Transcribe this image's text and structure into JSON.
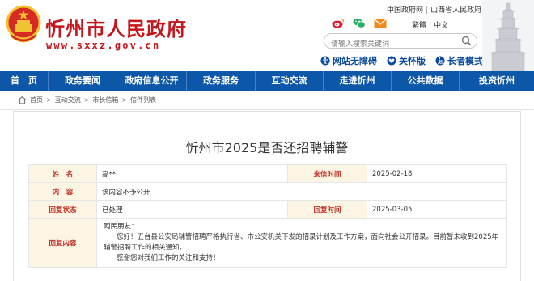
{
  "header": {
    "site_title": "忻州市人民政府",
    "site_url": "www.sxxz.gov.cn",
    "top_links": [
      "中国政府网",
      "山西省人民政府"
    ],
    "languages": [
      "繁體",
      "中文"
    ],
    "search_placeholder": "请输入搜索关键词",
    "tools": [
      "网站无障碍",
      "关怀版",
      "长者模式"
    ]
  },
  "nav": {
    "items": [
      "首　页",
      "政务要闻",
      "政府信息公开",
      "政务服务",
      "互动交流",
      "走进忻州",
      "公共数据",
      "投资忻州"
    ]
  },
  "breadcrumb": [
    "首页",
    "互动交流",
    "市长信箱",
    "信件列表"
  ],
  "letter": {
    "title": "忻州市2025是否还招聘辅警",
    "name_label": "姓　名",
    "name_value": "高**",
    "date_label": "来信时间",
    "date_value": "2025-02-18",
    "content_label": "内　容",
    "content_value": "该内容不予公开",
    "status_label": "回复状态",
    "status_value": "已处理",
    "reply_time_label": "回复时间",
    "reply_time_value": "2025-03-05",
    "reply_label": "回复内容",
    "reply_greeting": "网民朋友：",
    "reply_body": "您好！五台县公安局辅警招聘严格执行省、市公安机关下发的招录计划及工作方案，面向社会公开招录。目前暂未收到2025年辅警招聘工作的相关通知。",
    "reply_closing": "感谢您对我们工作的关注和支持！"
  },
  "colors": {
    "brand_red": "#c4161c",
    "nav_blue": "#0c57a8",
    "label_bg": "#fdf5e3",
    "label_text": "#c03027"
  }
}
